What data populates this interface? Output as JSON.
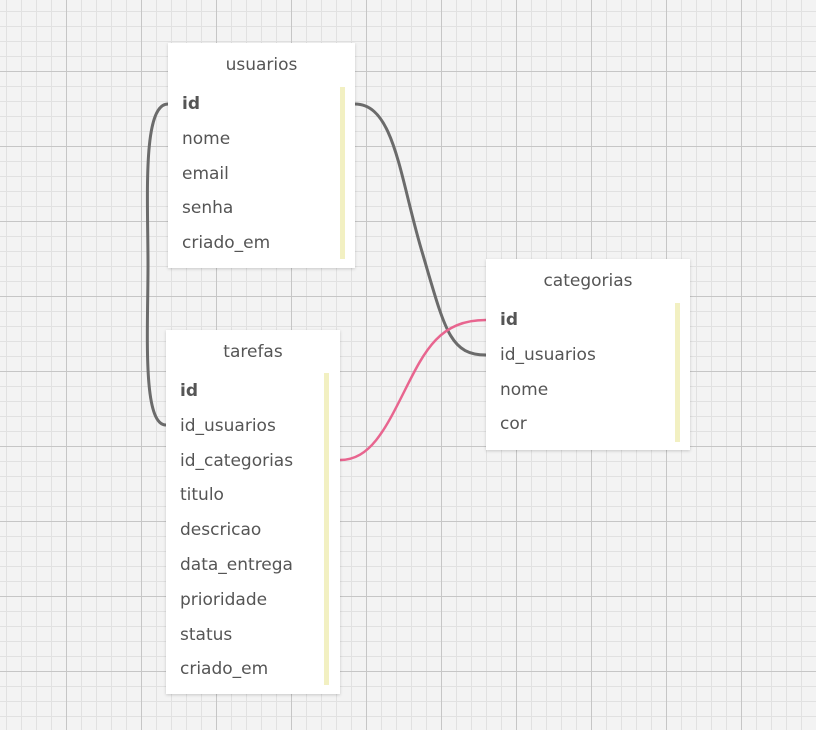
{
  "tables": {
    "usuarios": {
      "name": "usuarios",
      "fields": [
        "id",
        "nome",
        "email",
        "senha",
        "criado_em"
      ]
    },
    "tarefas": {
      "name": "tarefas",
      "fields": [
        "id",
        "id_usuarios",
        "id_categorias",
        "titulo",
        "descricao",
        "data_entrega",
        "prioridade",
        "status",
        "criado_em"
      ]
    },
    "categorias": {
      "name": "categorias",
      "fields": [
        "id",
        "id_usuarios",
        "nome",
        "cor"
      ]
    }
  },
  "relations": [
    {
      "from": "usuarios.id",
      "to": "tarefas.id_usuarios",
      "color": "#6b6b6b"
    },
    {
      "from": "usuarios.id",
      "to": "categorias.id_usuarios",
      "color": "#6b6b6b"
    },
    {
      "from": "categorias.id",
      "to": "tarefas.id_categorias",
      "color": "#e8658f"
    }
  ],
  "colors": {
    "canvas_background": "#f3f3f3",
    "grid_major": "#c6c6c6",
    "grid_minor": "#e1e1e1",
    "table_background": "#ffffff",
    "field_text": "#555555",
    "accent_bar": "#f2f0c2"
  }
}
